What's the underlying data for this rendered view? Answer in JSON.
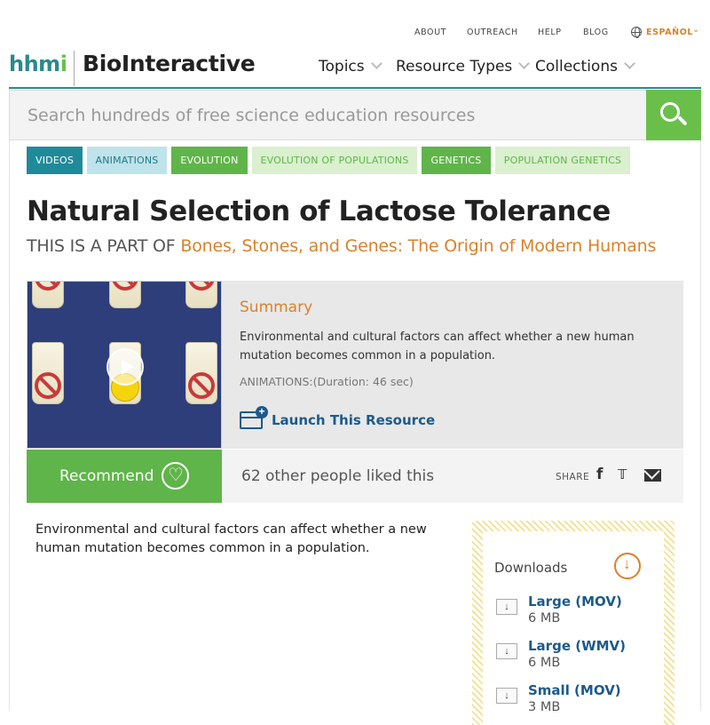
{
  "utility_nav": {
    "about": "ABOUT",
    "outreach": "OUTREACH",
    "help": "HELP",
    "blog": "BLOG",
    "language": "ESPAÑOL"
  },
  "header": {
    "logo_hhmi_h": "hhm",
    "logo_hhmi_i": "i",
    "logo_biointeractive": "BioInteractive",
    "nav": [
      "Topics",
      "Resource Types",
      "Collections"
    ]
  },
  "search": {
    "placeholder": "Search hundreds of free science education resources"
  },
  "tags": [
    "VIDEOS",
    "ANIMATIONS",
    "EVOLUTION",
    "EVOLUTION OF POPULATIONS",
    "GENETICS",
    "POPULATION GENETICS"
  ],
  "page": {
    "title": "Natural Selection of Lactose Tolerance",
    "part_of_prefix": "THIS IS A PART OF",
    "part_of_link": "Bones, Stones, and Genes: The Origin of Modern Humans"
  },
  "card": {
    "summary_title": "Summary",
    "summary_text": "Environmental and cultural factors can affect whether a new human mutation becomes common in a population.",
    "meta": "ANIMATIONS:(Duration: 46 sec)",
    "launch_label": "Launch This Resource",
    "recommend_label": "Recommend",
    "likes_text": "62 other people liked this",
    "share_label": "SHARE"
  },
  "body": {
    "description": "Environmental and cultural factors can affect whether a new human mutation becomes common in a population."
  },
  "downloads": {
    "title": "Downloads",
    "items": [
      {
        "name": "Large (MOV)",
        "size": "6 MB"
      },
      {
        "name": "Large (WMV)",
        "size": "6 MB"
      },
      {
        "name": "Small (MOV)",
        "size": "3 MB"
      }
    ]
  },
  "colors": {
    "teal": "#2a8a8a",
    "green": "#6abf4b",
    "orange": "#d9822b",
    "link_blue": "#1d5a8a"
  }
}
